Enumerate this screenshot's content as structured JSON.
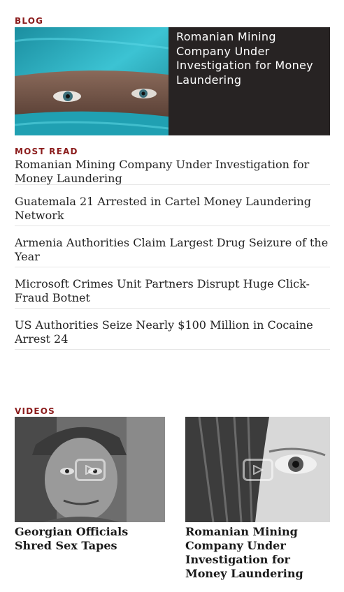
{
  "blog": {
    "label": "BLOG",
    "featured_title": "Romanian Mining Company Under Investigation for Money Laundering"
  },
  "most_read": {
    "label": "MOST READ",
    "items": [
      "Romanian Mining Company Under Investigation for Money Laundering",
      "Guatemala 21 Arrested in Cartel Money Laundering Network",
      "Armenia Authorities Claim Largest Drug Seizure of the Year",
      "Microsoft Crimes Unit Partners Disrupt Huge Click-Fraud Botnet",
      "US Authorities Seize Nearly $100 Million in Cocaine Arrest 24"
    ]
  },
  "videos": {
    "label": "VIDEOS",
    "items": [
      {
        "title": "Georgian Officials Shred Sex Tapes",
        "icon": "play-icon"
      },
      {
        "title": "Romanian Mining Company Under Investigation for Money Laundering",
        "icon": "play-icon"
      }
    ]
  },
  "colors": {
    "accent": "#8b1c1c",
    "card_bg": "#272323"
  }
}
